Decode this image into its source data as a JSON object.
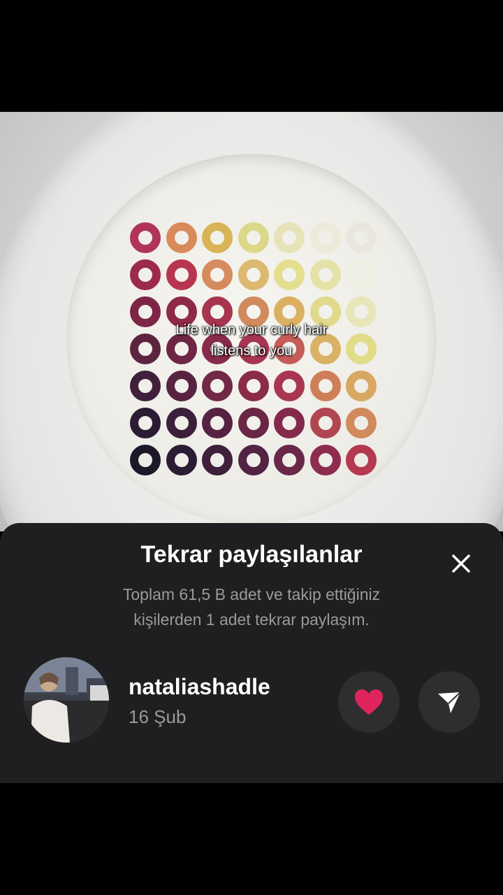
{
  "video": {
    "caption_line1": "Life when your curly hair",
    "caption_line2": "listens to you"
  },
  "reposts_sheet": {
    "title": "Tekrar paylaşılanlar",
    "subtitle_line1": "Toplam 61,5 B adet ve takip ettiğiniz",
    "subtitle_line2": "kişilerden 1 adet tekrar paylaşım.",
    "close_icon": "close-icon"
  },
  "repost_user": {
    "username": "nataliashadle",
    "date": "16 Şub",
    "like_icon": "heart-icon",
    "send_icon": "send-icon"
  },
  "colors": {
    "sheet_bg": "#1f1f21",
    "heart": "#e0245e"
  }
}
